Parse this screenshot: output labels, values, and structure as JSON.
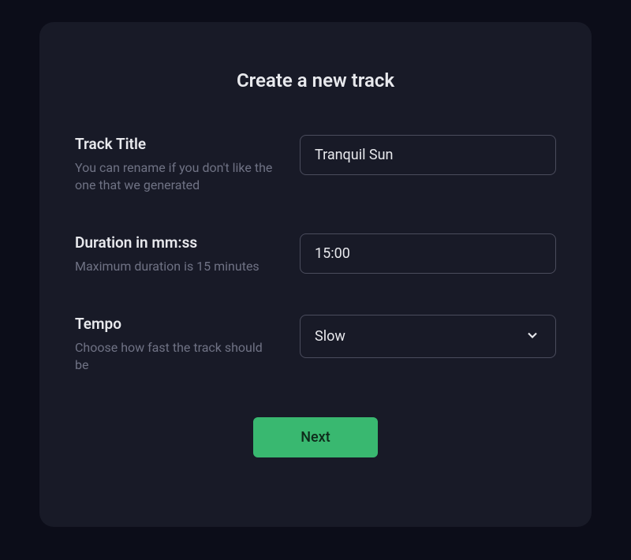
{
  "modal": {
    "title": "Create a new track"
  },
  "fields": {
    "title": {
      "label": "Track Title",
      "description": "You can rename if you don't like the one that we generated",
      "value": "Tranquil Sun"
    },
    "duration": {
      "label": "Duration in mm:ss",
      "description": "Maximum duration is 15 minutes",
      "value": "15:00"
    },
    "tempo": {
      "label": "Tempo",
      "description": "Choose how fast the track should be",
      "value": "Slow"
    }
  },
  "buttons": {
    "next": "Next"
  }
}
